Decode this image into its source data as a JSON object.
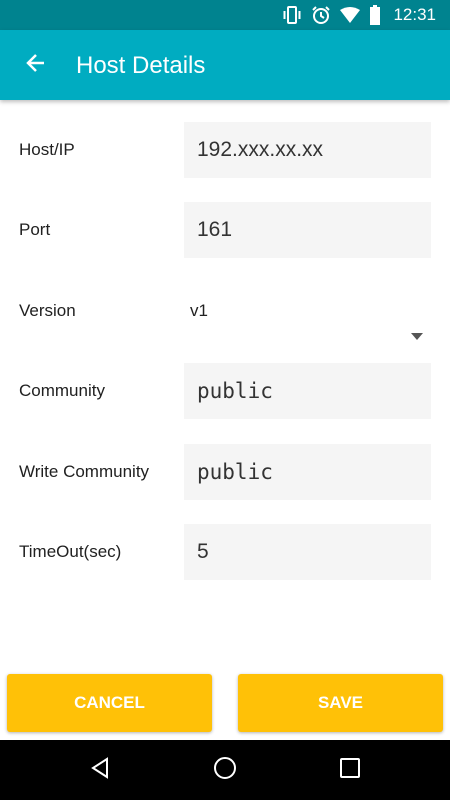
{
  "status_bar": {
    "time": "12:31",
    "icons": [
      "vibrate-icon",
      "alarm-icon",
      "wifi-icon",
      "battery-icon"
    ]
  },
  "app_bar": {
    "title": "Host Details",
    "back_icon": "arrow-back-icon",
    "color": "#00acc1",
    "status_color": "#00838f"
  },
  "form": {
    "host": {
      "label": "Host/IP",
      "value": "192.xxx.xx.xx"
    },
    "port": {
      "label": "Port",
      "value": "161"
    },
    "version": {
      "label": "Version",
      "value": "v1"
    },
    "community": {
      "label": "Community",
      "value": "public"
    },
    "write_community": {
      "label": "Write Community",
      "value": "public"
    },
    "timeout": {
      "label": "TimeOut(sec)",
      "value": "5"
    }
  },
  "buttons": {
    "cancel_label": "CANCEL",
    "save_label": "SAVE",
    "color": "#ffc107"
  },
  "nav_bar": {
    "icons": [
      "back-triangle-icon",
      "home-circle-icon",
      "recents-square-icon"
    ]
  }
}
